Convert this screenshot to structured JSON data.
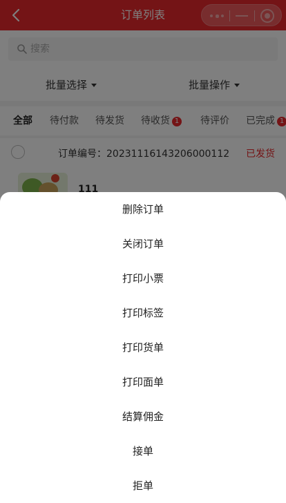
{
  "header": {
    "title": "订单列表"
  },
  "search": {
    "placeholder": "搜索"
  },
  "batch": {
    "select_label": "批量选择",
    "operate_label": "批量操作"
  },
  "tabs": [
    {
      "label": "全部",
      "active": true
    },
    {
      "label": "待付款"
    },
    {
      "label": "待发货"
    },
    {
      "label": "待收货",
      "badge": "1"
    },
    {
      "label": "待评价"
    },
    {
      "label": "已完成",
      "badge": "1"
    }
  ],
  "order": {
    "number_text": "订单编号：20231116143206000112",
    "status": "已发货",
    "product_name": "111"
  },
  "action_sheet": {
    "items": [
      "删除订单",
      "关闭订单",
      "打印小票",
      "打印标签",
      "打印货单",
      "打印面单",
      "结算佣金",
      "接单",
      "拒单"
    ]
  },
  "colors": {
    "brand": "#e8282c",
    "overlay": "rgba(0,0,0,0.5)"
  }
}
